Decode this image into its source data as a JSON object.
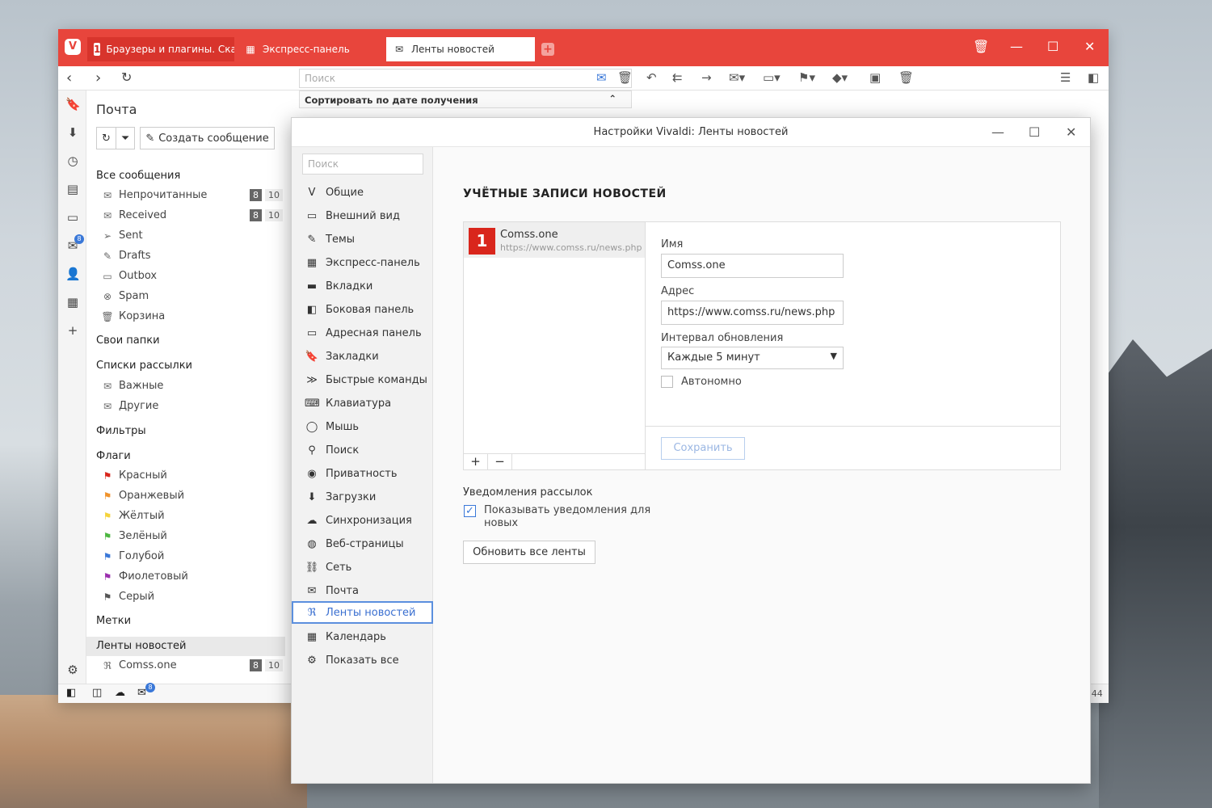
{
  "tabs": [
    {
      "label": "Браузеры и плагины. Скач"
    },
    {
      "label": "Экспресс-панель"
    },
    {
      "label": "Ленты новостей"
    }
  ],
  "toolbar": {
    "search_placeholder": "Поиск"
  },
  "message_list": {
    "sort_label": "Сортировать по дате получения"
  },
  "mail_panel": {
    "title": "Почта",
    "create_label": "Создать сообщение",
    "all_messages": "Все сообщения",
    "folders": [
      {
        "label": "Непрочитанные",
        "unread": "8",
        "total": "10"
      },
      {
        "label": "Received",
        "unread": "8",
        "total": "10"
      },
      {
        "label": "Sent"
      },
      {
        "label": "Drafts"
      },
      {
        "label": "Outbox"
      },
      {
        "label": "Spam"
      },
      {
        "label": "Корзина"
      }
    ],
    "own_folders": "Свои папки",
    "mailing_lists": "Списки рассылки",
    "lists": [
      {
        "label": "Важные"
      },
      {
        "label": "Другие"
      }
    ],
    "filters": "Фильтры",
    "flags_title": "Флаги",
    "flags": [
      {
        "label": "Красный",
        "color": "#d9261c"
      },
      {
        "label": "Оранжевый",
        "color": "#f0932b"
      },
      {
        "label": "Жёлтый",
        "color": "#f5d33b"
      },
      {
        "label": "Зелёный",
        "color": "#4cb640"
      },
      {
        "label": "Голубой",
        "color": "#3a78d8"
      },
      {
        "label": "Фиолетовый",
        "color": "#9b2fae"
      },
      {
        "label": "Серый",
        "color": "#555555"
      }
    ],
    "labels": "Метки",
    "feeds_title": "Ленты новостей",
    "feeds": [
      {
        "label": "Comss.one",
        "unread": "8",
        "total": "10"
      }
    ],
    "badge": "8"
  },
  "settings": {
    "title": "Настройки Vivaldi: Ленты новостей",
    "search_placeholder": "Поиск",
    "nav": [
      "Общие",
      "Внешний вид",
      "Темы",
      "Экспресс-панель",
      "Вкладки",
      "Боковая панель",
      "Адресная панель",
      "Закладки",
      "Быстрые команды",
      "Клавиатура",
      "Мышь",
      "Поиск",
      "Приватность",
      "Загрузки",
      "Синхронизация",
      "Веб-страницы",
      "Сеть",
      "Почта",
      "Ленты новостей",
      "Календарь",
      "Показать все"
    ],
    "heading": "УЧЁТНЫЕ ЗАПИСИ НОВОСТЕЙ",
    "account": {
      "name": "Comss.one",
      "url": "https://www.comss.ru/news.php"
    },
    "form": {
      "name_label": "Имя",
      "name_value": "Comss.one",
      "address_label": "Адрес",
      "address_value": "https://www.comss.ru/news.php",
      "interval_label": "Интервал обновления",
      "interval_value": "Каждые 5 минут",
      "offline_label": "Автономно",
      "save_label": "Сохранить"
    },
    "notifications_title": "Уведомления рассылок",
    "notifications_text": "Показывать уведомления для новых",
    "refresh_label": "Обновить все ленты"
  },
  "status_time": ":44"
}
